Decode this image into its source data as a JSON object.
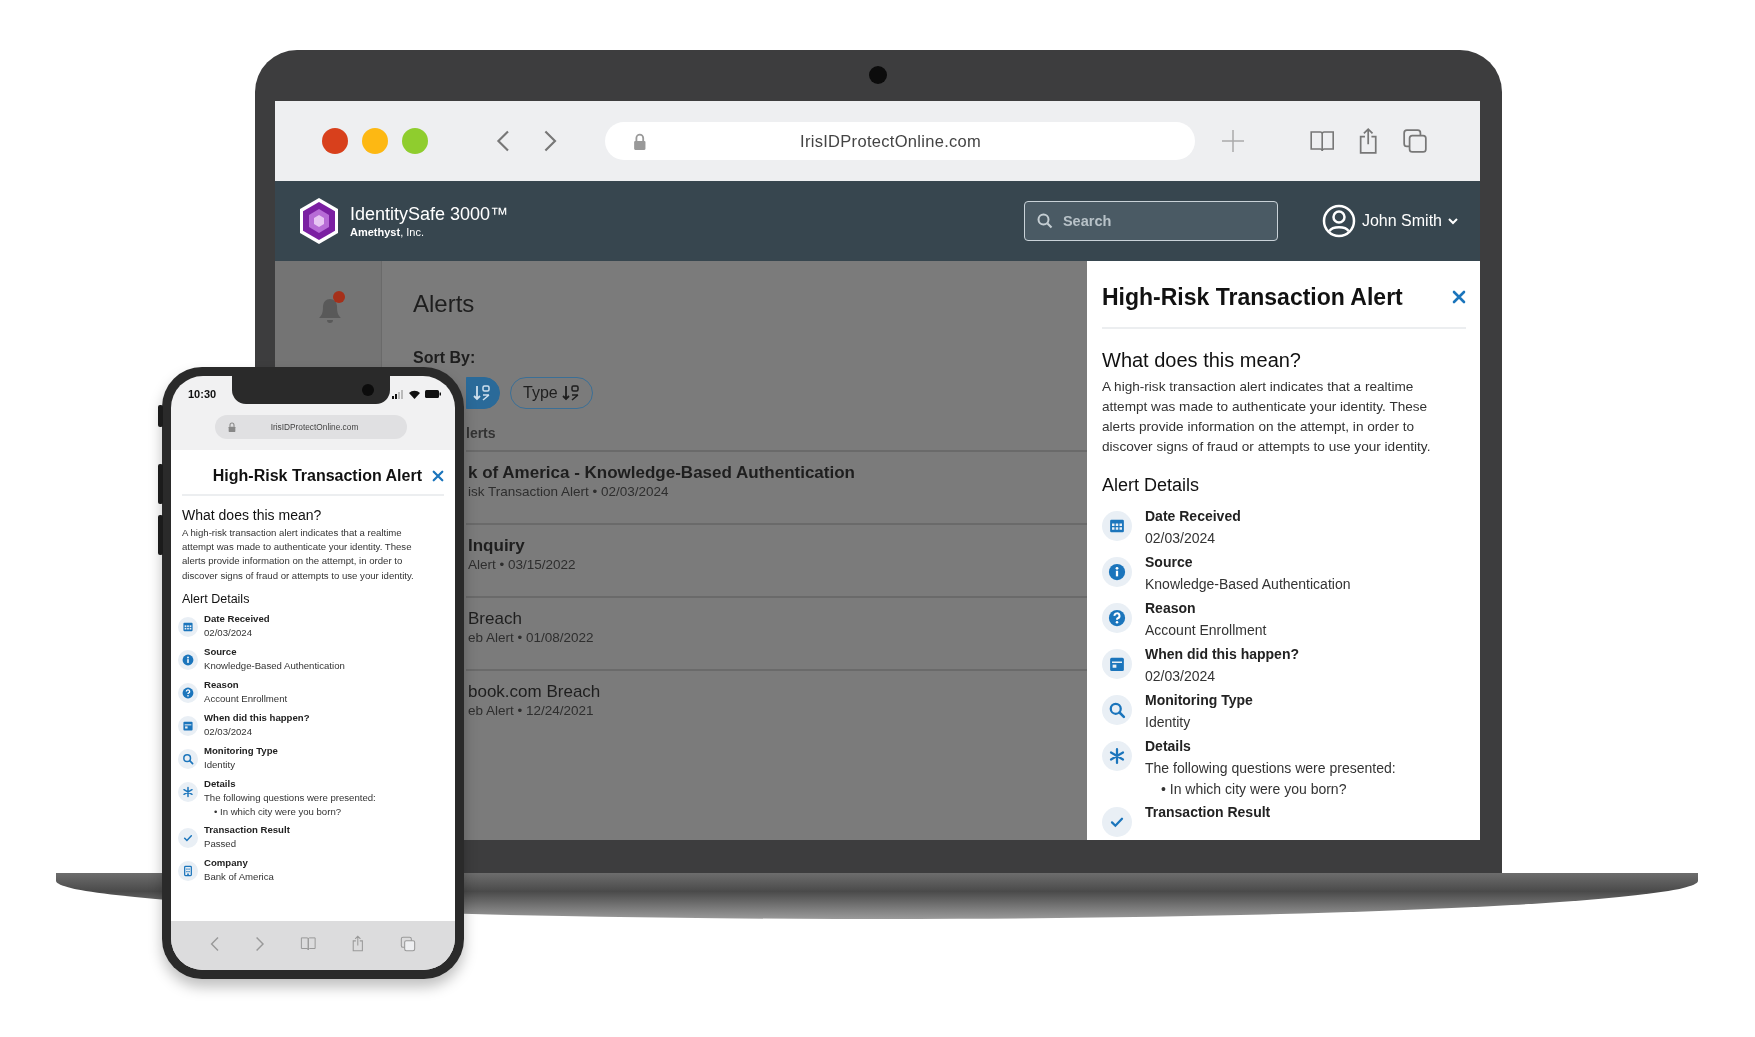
{
  "browser": {
    "url": "IrisIDProtectOnline.com"
  },
  "app_header": {
    "brand": "IdentitySafe 3000™",
    "company": "**Amethyst**, Inc.",
    "search": {
      "placeholder": "Search"
    },
    "user": "John Smith"
  },
  "alerts": {
    "title": "Alerts",
    "sort_label": "Sort By:",
    "sort_buttons": [
      {
        "selected": true
      },
      {
        "label": "Type",
        "selected": false
      }
    ],
    "list_header": "lerts",
    "items": [
      {
        "title": "k of America - Knowledge-Based Authentication",
        "subtitle": "isk Transaction Alert • 02/03/2024",
        "unread": true
      },
      {
        "title": "Inquiry",
        "subtitle": "Alert • 03/15/2022",
        "unread": true
      },
      {
        "title": "Breach",
        "subtitle": "eb Alert • 01/08/2022",
        "unread": false
      },
      {
        "title": "book.com Breach",
        "subtitle": "eb Alert • 12/24/2021",
        "unread": false
      }
    ]
  },
  "detail_panel": {
    "title": "High-Risk Transaction Alert",
    "section_title": "What does this mean?",
    "description": "A high-risk transaction alert indicates that a realtime attempt was made to authenticate your identity. These alerts provide information on the attempt, in order to discover signs of fraud or attempts to use your identity.",
    "details_title": "Alert Details",
    "details": [
      {
        "label": "Date Received",
        "value": "02/03/2024"
      },
      {
        "label": "Source",
        "value": "Knowledge-Based Authentication"
      },
      {
        "label": "Reason",
        "value": "Account Enrollment"
      },
      {
        "label": "When did this happen?",
        "value": "02/03/2024"
      },
      {
        "label": "Monitoring Type",
        "value": "Identity"
      },
      {
        "label": "Details",
        "value": "The following questions were presented:",
        "bullets": [
          "• In which city were you born?"
        ]
      },
      {
        "label": "Transaction Result"
      }
    ]
  },
  "phone": {
    "time": "10:30",
    "url": "IrisIDProtectOnline.com",
    "panel": {
      "title": "High-Risk Transaction Alert",
      "section_title": "What does this mean?",
      "description": "A high-risk transaction alert indicates that a realtime attempt was made to authenticate your identity. These alerts provide information on the attempt, in order to discover signs of fraud or attempts to use your identity.",
      "details_title": "Alert Details",
      "details": [
        {
          "label": "Date Received",
          "value": "02/03/2024"
        },
        {
          "label": "Source",
          "value": "Knowledge-Based Authentication"
        },
        {
          "label": "Reason",
          "value": "Account Enrollment"
        },
        {
          "label": "When did this happen?",
          "value": "02/03/2024"
        },
        {
          "label": "Monitoring Type",
          "value": "Identity"
        },
        {
          "label": "Details",
          "value": "The following questions were presented:",
          "bullets": [
            "• In which city were you born?"
          ]
        },
        {
          "label": "Transaction Result",
          "value": "Passed"
        },
        {
          "label": "Company",
          "value": "Bank of America"
        }
      ]
    }
  }
}
